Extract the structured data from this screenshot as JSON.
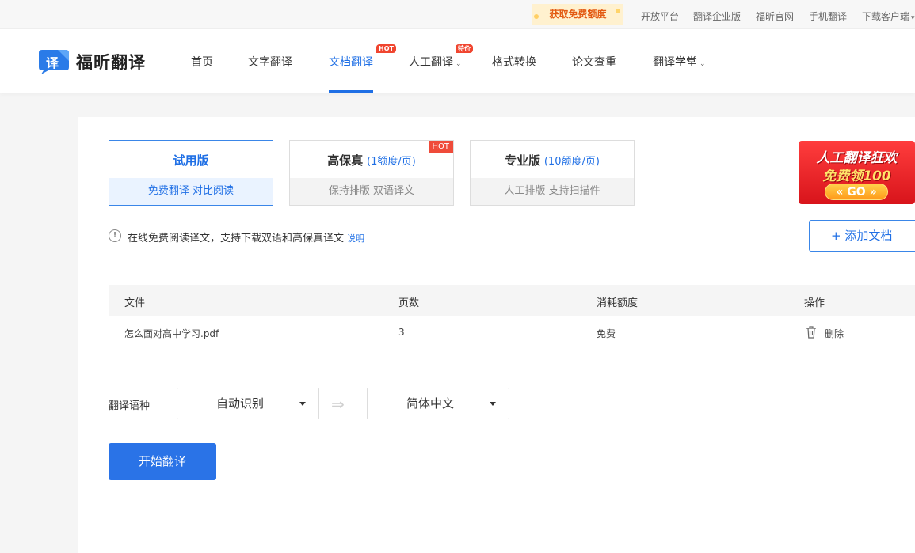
{
  "topbar": {
    "promo": "获取免费额度",
    "links": [
      "开放平台",
      "翻译企业版",
      "福昕官网",
      "手机翻译",
      "下载客户端"
    ]
  },
  "header": {
    "logo_char": "译",
    "logo_text": "福昕翻译",
    "nav": [
      {
        "label": "首页"
      },
      {
        "label": "文字翻译"
      },
      {
        "label": "文档翻译",
        "badge": "HOT",
        "active": true
      },
      {
        "label": "人工翻译",
        "badge": "特价"
      },
      {
        "label": "格式转换"
      },
      {
        "label": "论文查重"
      },
      {
        "label": "翻译学堂"
      }
    ]
  },
  "plans": [
    {
      "title": "试用版",
      "price": "",
      "features": "免费翻译   对比阅读",
      "selected": true
    },
    {
      "title": "高保真",
      "price": "(1额度/页)",
      "features": "保持排版   双语译文",
      "hot": "HOT"
    },
    {
      "title": "专业版",
      "price": "(10额度/页)",
      "features": "人工排版   支持扫描件"
    }
  ],
  "ad": {
    "line1": "人工翻译狂欢",
    "line2": "免费领100",
    "button": "GO"
  },
  "info": {
    "text": "在线免费阅读译文，支持下载双语和高保真译文",
    "link": "说明"
  },
  "add_button": "+ 添加文档",
  "table": {
    "headers": [
      "文件",
      "页数",
      "消耗额度",
      "操作"
    ],
    "rows": [
      {
        "file": "怎么面对高中学习.pdf",
        "pages": "3",
        "cost": "免费",
        "action": "删除"
      }
    ]
  },
  "language": {
    "label": "翻译语种",
    "source": "自动识别",
    "target": "简体中文"
  },
  "start_button": "开始翻译",
  "colors": {
    "accent": "#1f6fe5",
    "hot": "#ef4b3a"
  }
}
